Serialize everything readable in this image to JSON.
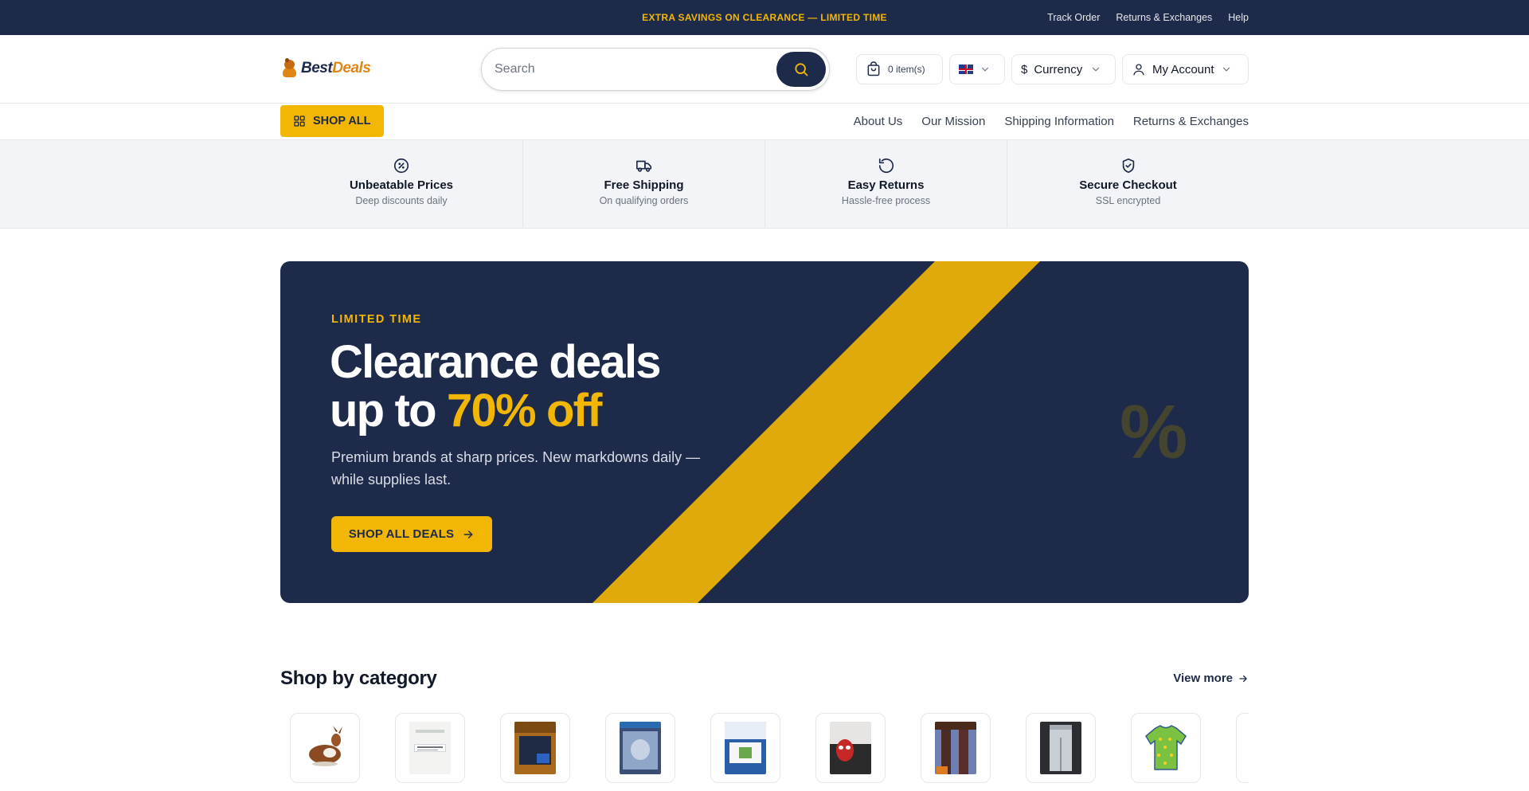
{
  "topbar": {
    "promo": "EXTRA SAVINGS ON CLEARANCE — LIMITED TIME",
    "links": [
      "Track Order",
      "Returns & Exchanges",
      "Help"
    ]
  },
  "header": {
    "logo": {
      "part1": "Best",
      "part2": "Deals"
    },
    "search": {
      "placeholder": "Search",
      "value": ""
    },
    "cart": {
      "label": "0 item(s)",
      "icon": "cart-icon"
    },
    "language": {
      "flag": "uk-flag"
    },
    "currency": {
      "symbol": "$",
      "label": "Currency"
    },
    "account": {
      "label": "My Account"
    }
  },
  "nav": {
    "shop_all": "SHOP ALL",
    "links": [
      "About Us",
      "Our Mission",
      "Shipping Information",
      "Returns & Exchanges"
    ]
  },
  "features": [
    {
      "title": "Unbeatable Prices",
      "subtitle": "Deep discounts daily",
      "icon": "discount-icon"
    },
    {
      "title": "Free Shipping",
      "subtitle": "On qualifying orders",
      "icon": "truck-icon"
    },
    {
      "title": "Easy Returns",
      "subtitle": "Hassle-free process",
      "icon": "return-icon"
    },
    {
      "title": "Secure Checkout",
      "subtitle": "SSL encrypted",
      "icon": "shield-check-icon"
    }
  ],
  "hero": {
    "eyebrow": "LIMITED TIME",
    "headline_line1": "Clearance deals",
    "headline_prefix": "up to ",
    "headline_highlight": "70% off",
    "subtitle": "Premium brands at sharp prices. New markdowns daily — while supplies last.",
    "cta": "SHOP ALL DEALS",
    "decor_symbol": "%"
  },
  "categories": {
    "title": "Shop by category",
    "view_more": "View more",
    "items": [
      "deer-figurine",
      "white-packet",
      "boxed-media",
      "blu-ray-case",
      "appliance-box",
      "spider-mask",
      "curtain-fabric",
      "denim-jeans",
      "green-shirt",
      "partial-item"
    ]
  },
  "colors": {
    "navy": "#1e2a4a",
    "accent": "#f2b705",
    "stripe": "#e0aa0a",
    "feature_bg": "#f2f4f7"
  }
}
